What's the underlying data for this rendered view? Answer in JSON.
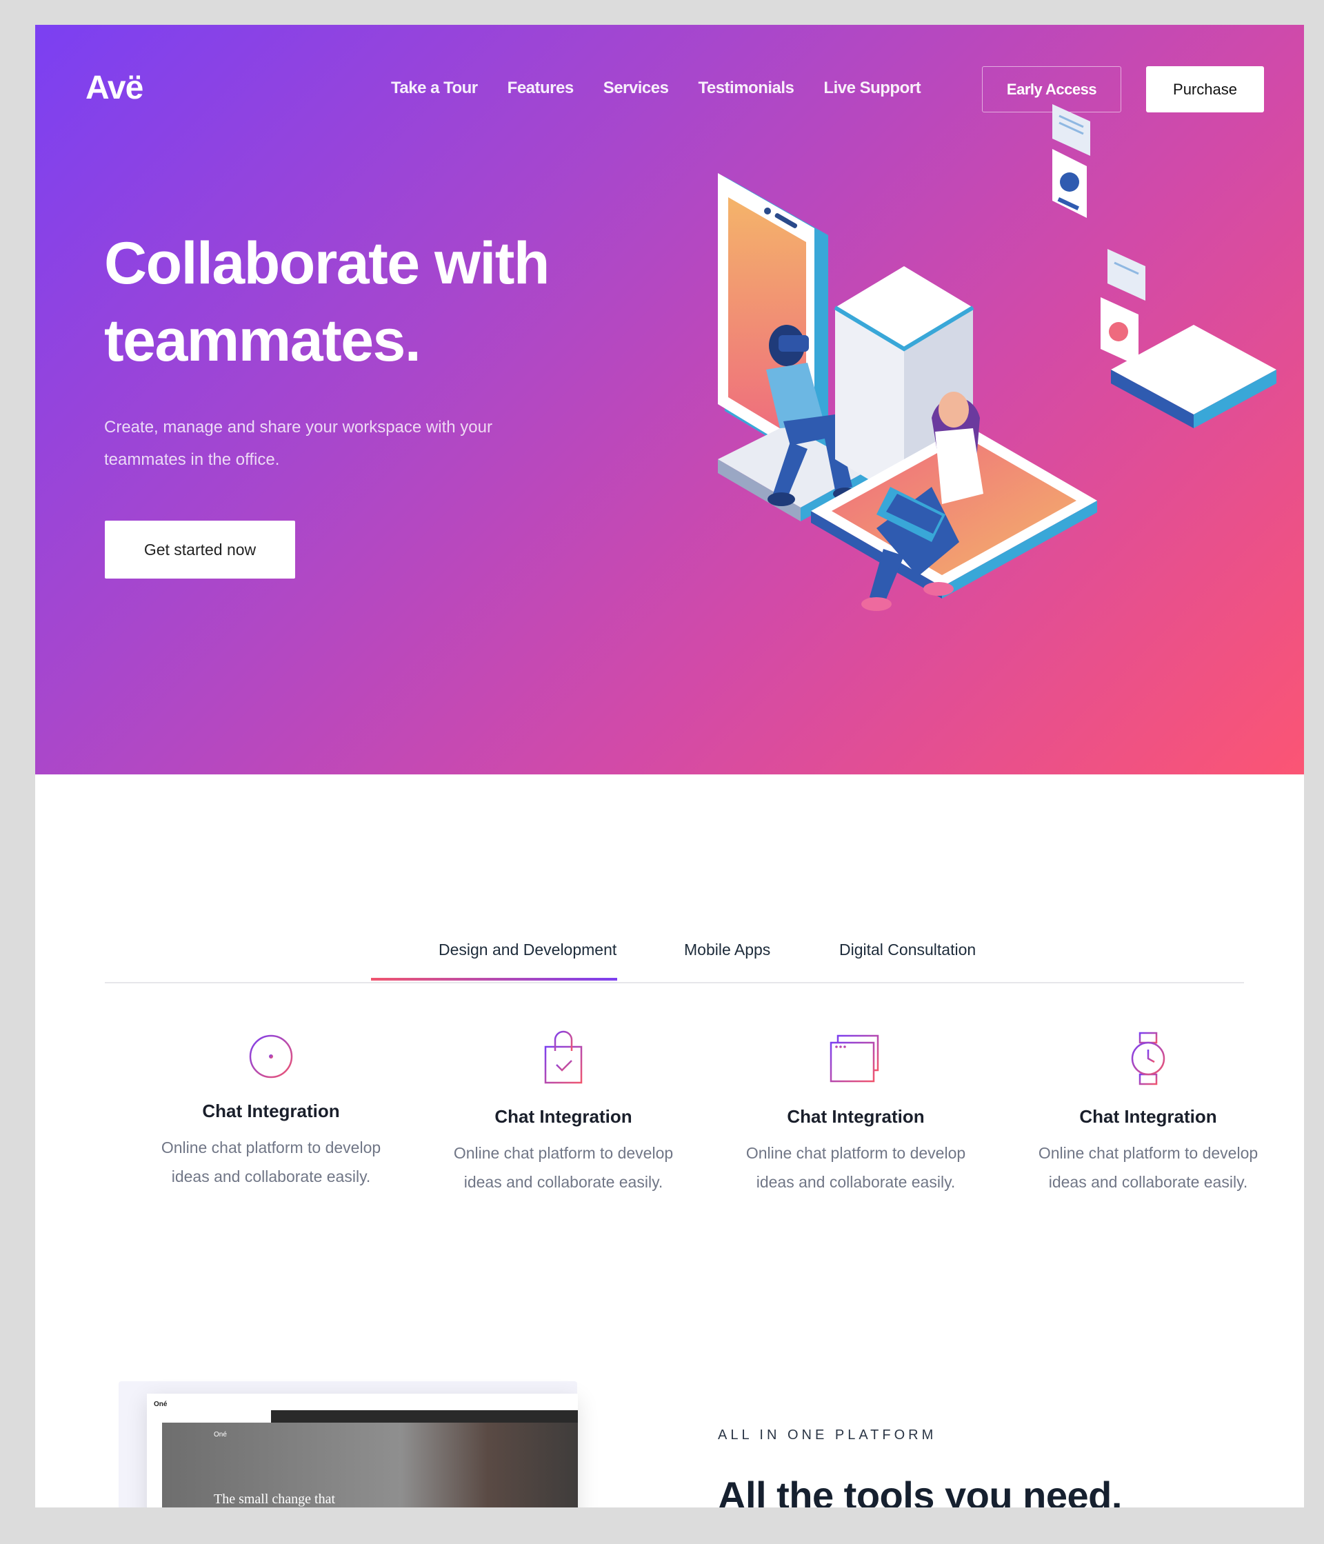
{
  "brand": {
    "logo": "Avë"
  },
  "nav": {
    "items": [
      "Take a Tour",
      "Features",
      "Services",
      "Testimonials",
      "Live Support"
    ],
    "early_access": "Early Access",
    "purchase": "Purchase"
  },
  "hero": {
    "title_line1": "Collaborate with",
    "title_line2": "teammates.",
    "subtitle_line1": "Create, manage and share your workspace with your",
    "subtitle_line2": "teammates in the office.",
    "cta": "Get started now"
  },
  "tabs": {
    "items": [
      "Design and Development",
      "Mobile Apps",
      "Digital Consultation"
    ],
    "active": "Design and Development"
  },
  "features": [
    {
      "icon": "stopwatch-icon",
      "title": "Chat Integration",
      "line1": "Online chat platform to develop",
      "line2": "ideas and collaborate easily."
    },
    {
      "icon": "shopping-bag-icon",
      "title": "Chat Integration",
      "line1": "Online chat platform to develop",
      "line2": "ideas and collaborate easily."
    },
    {
      "icon": "browser-windows-icon",
      "title": "Chat Integration",
      "line1": "Online chat platform to develop",
      "line2": "ideas and collaborate easily."
    },
    {
      "icon": "wristwatch-icon",
      "title": "Chat Integration",
      "line1": "Online chat platform to develop",
      "line2": "ideas and collaborate easily."
    }
  ],
  "platform": {
    "kicker": "ALL IN ONE PLATFORM",
    "title": "All the tools you need.",
    "screenshot": {
      "brand": "Oné",
      "brand2": "Oné",
      "headline": "The small change that"
    }
  },
  "colors": {
    "gradient_start": "#7b40f2",
    "gradient_end": "#fb5574",
    "text_dark": "#1a1f2b",
    "text_muted": "#707686"
  }
}
